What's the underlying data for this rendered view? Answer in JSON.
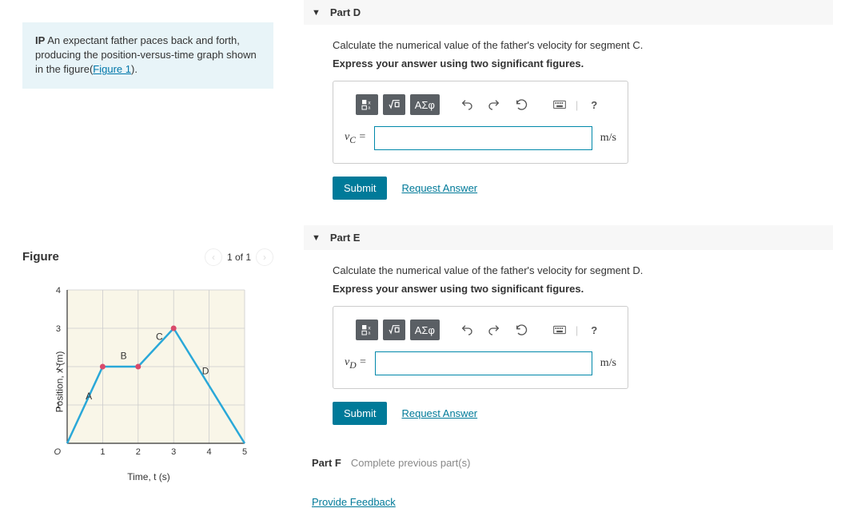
{
  "problem": {
    "bold_prefix": "IP",
    "text_1": " An expectant father paces back and forth, producing the position-versus-time graph shown in the figure",
    "figure_link_open": "(",
    "figure_link_label": "Figure 1",
    "figure_link_close": ")."
  },
  "figure": {
    "title": "Figure",
    "nav_text": "1 of 1",
    "ylabel": "Position, x (m)",
    "xlabel": "Time, t (s)"
  },
  "chart_data": {
    "type": "line",
    "title": "",
    "xlabel": "Time, t (s)",
    "ylabel": "Position, x (m)",
    "x": [
      0,
      1,
      2,
      3,
      5
    ],
    "y": [
      0,
      2,
      2,
      3,
      0
    ],
    "xlim": [
      0,
      5
    ],
    "ylim": [
      0,
      4
    ],
    "xticks": [
      1,
      2,
      3,
      4,
      5
    ],
    "yticks": [
      1,
      2,
      3,
      4
    ],
    "origin_label": "O",
    "segments": [
      {
        "name": "A",
        "label_x": 0.52,
        "label_y": 1.15
      },
      {
        "name": "B",
        "label_x": 1.5,
        "label_y": 2.2
      },
      {
        "name": "C",
        "label_x": 2.5,
        "label_y": 2.7
      },
      {
        "name": "D",
        "label_x": 3.8,
        "label_y": 1.8
      }
    ],
    "markers": [
      {
        "x": 1,
        "y": 2
      },
      {
        "x": 2,
        "y": 2
      },
      {
        "x": 3,
        "y": 3
      }
    ]
  },
  "parts": {
    "d": {
      "label": "Part D",
      "instruction": "Calculate the numerical value of the father's velocity for segment C.",
      "hint": "Express your answer using two significant figures.",
      "var_prefix": "v",
      "var_sub": "C",
      "equals": " =",
      "unit": "m/s",
      "submit": "Submit",
      "request": "Request Answer"
    },
    "e": {
      "label": "Part E",
      "instruction": "Calculate the numerical value of the father's velocity for segment D.",
      "hint": "Express your answer using two significant figures.",
      "var_prefix": "v",
      "var_sub": "D",
      "equals": " =",
      "unit": "m/s",
      "submit": "Submit",
      "request": "Request Answer"
    },
    "f": {
      "label": "Part F",
      "msg": "Complete previous part(s)"
    }
  },
  "toolbar": {
    "greek": "ΑΣφ",
    "help": "?"
  },
  "feedback": "Provide Feedback"
}
